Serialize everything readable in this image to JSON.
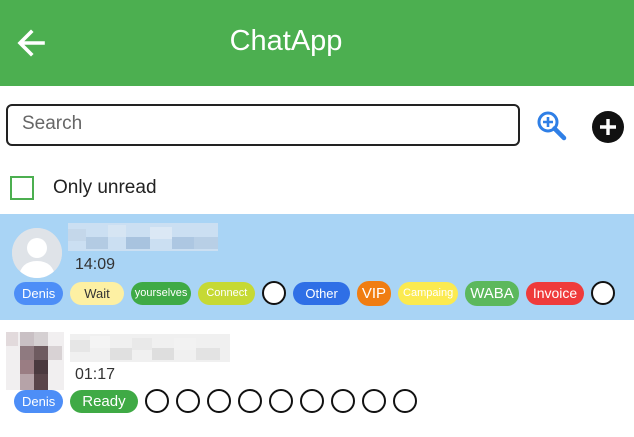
{
  "header": {
    "title": "ChatApp"
  },
  "search": {
    "placeholder": "Search"
  },
  "filter": {
    "label": "Only unread"
  },
  "chats": [
    {
      "time": "14:09",
      "selected": true,
      "tags": [
        {
          "label": "Denis",
          "color": "#4d8ef7",
          "text_color": "#ffffff"
        },
        {
          "label": "Wait",
          "color": "#fdf0a3",
          "text_color": "#333333"
        },
        {
          "label": "yourselves",
          "color": "#3faa45",
          "text_color": "#ffffff"
        },
        {
          "label": "Connect",
          "color": "#c6d934",
          "text_color": "#ffffff"
        },
        {
          "label": "Other",
          "color": "#2f6fe6",
          "text_color": "#ffffff"
        },
        {
          "label": "VIP",
          "color": "#f07d12",
          "text_color": "#ffffff"
        },
        {
          "label": "Campaing",
          "color": "#fbea50",
          "text_color": "#ffffff"
        },
        {
          "label": "WABA",
          "color": "#5cb85c",
          "text_color": "#ffffff"
        },
        {
          "label": "Invoice",
          "color": "#ef3b3b",
          "text_color": "#ffffff"
        }
      ],
      "empty_tag_slots": 2
    },
    {
      "time": "01:17",
      "selected": false,
      "tags": [
        {
          "label": "Denis",
          "color": "#4d8ef7",
          "text_color": "#ffffff"
        },
        {
          "label": "Ready",
          "color": "#3faa45",
          "text_color": "#ffffff"
        }
      ],
      "empty_tag_slots": 9
    }
  ],
  "colors": {
    "appbar": "#4caf50",
    "selected_row": "#a9d4f5",
    "search_icon": "#2f7fe6",
    "checkbox_border": "#4caf50"
  },
  "icons": {
    "back": "arrow-left-icon",
    "search": "zoom-in-icon",
    "add": "plus-circle-icon",
    "avatar_default": "person-placeholder-icon"
  }
}
